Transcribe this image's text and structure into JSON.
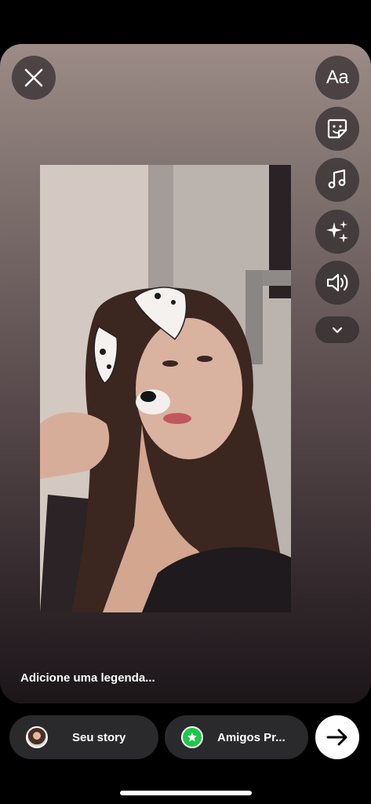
{
  "editor": {
    "caption_placeholder": "Adicione uma legenda...",
    "tools": {
      "text_label": "Aa",
      "items": [
        "close-icon",
        "text-tool",
        "sticker-icon",
        "music-icon",
        "sparkles-icon",
        "volume-icon",
        "chevron-down-icon"
      ]
    }
  },
  "share": {
    "story_label": "Seu story",
    "close_friends_label": "Amigos Pr..."
  },
  "colors": {
    "close_friends_green": "#1fc74a",
    "pill_bg": "#2a2a2c",
    "send_bg": "#ffffff"
  }
}
